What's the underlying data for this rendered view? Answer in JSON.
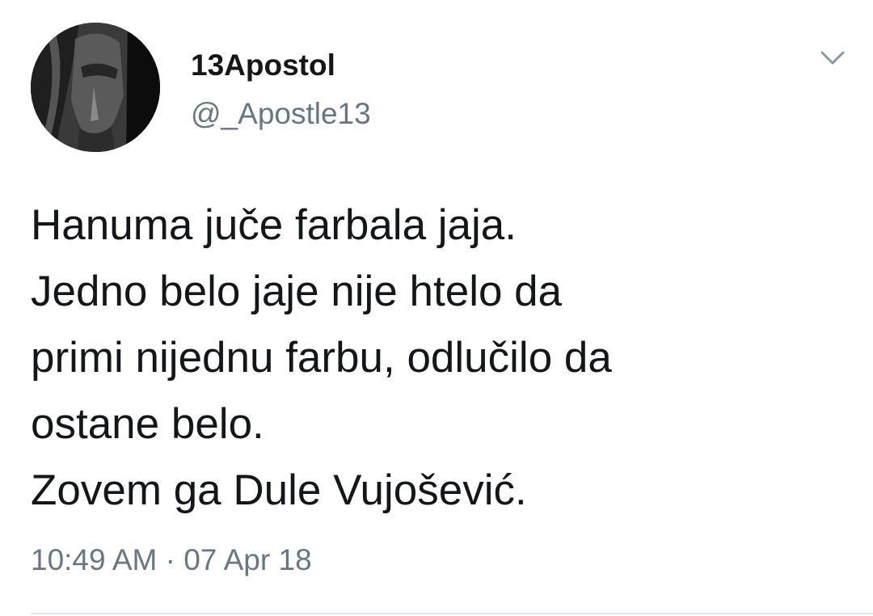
{
  "tweet": {
    "author": {
      "display_name": "13Apostol",
      "handle": "@_Apostle13",
      "avatar_icon": "avatar-photo"
    },
    "menu_icon": "chevron-down-icon",
    "text_lines": [
      "Hanuma juče farbala jaja.",
      "Jedno belo jaje nije htelo da",
      "primi nijednu farbu, odlučilo da",
      "ostane belo.",
      "Zovem ga Dule Vujošević."
    ],
    "time": "10:49 AM",
    "separator": " · ",
    "date": "07 Apr 18"
  },
  "colors": {
    "text": "#14171a",
    "secondary": "#657786",
    "divider": "#e1e8ed"
  }
}
